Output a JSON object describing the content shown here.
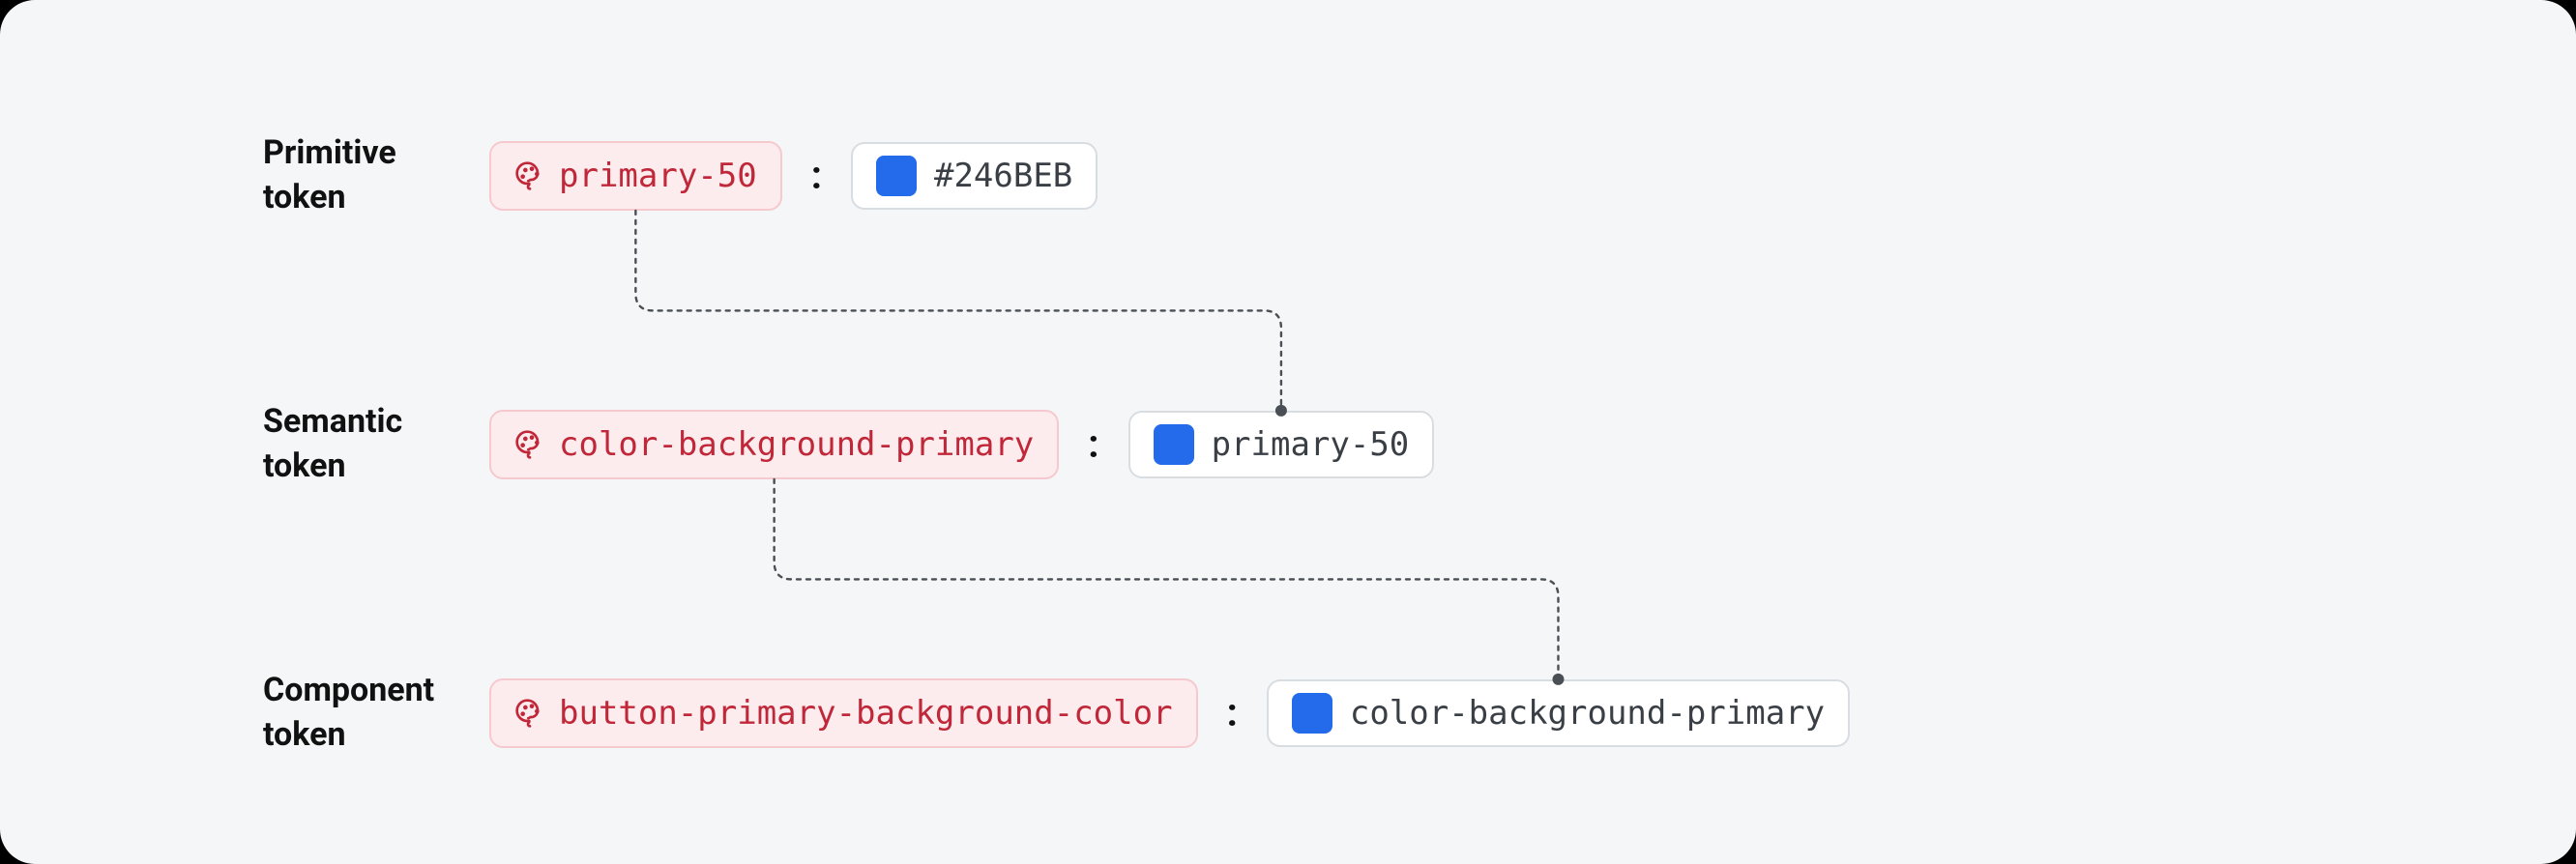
{
  "rows": [
    {
      "label": "Primitive\ntoken",
      "token": "primary-50",
      "value": "#246BEB",
      "swatch": "#246BEB"
    },
    {
      "label": "Semantic\ntoken",
      "token": "color-background-primary",
      "value": "primary-50",
      "swatch": "#246BEB"
    },
    {
      "label": "Component\ntoken",
      "token": "button-primary-background-color",
      "value": "color-background-primary",
      "swatch": "#246BEB"
    }
  ],
  "colors": {
    "tokenBg": "#fdecee",
    "tokenBorder": "#f6c9cf",
    "tokenText": "#c0283a",
    "valueBorder": "#d8dde2",
    "valueText": "#3a3f45",
    "swatch": "#246BEB"
  }
}
